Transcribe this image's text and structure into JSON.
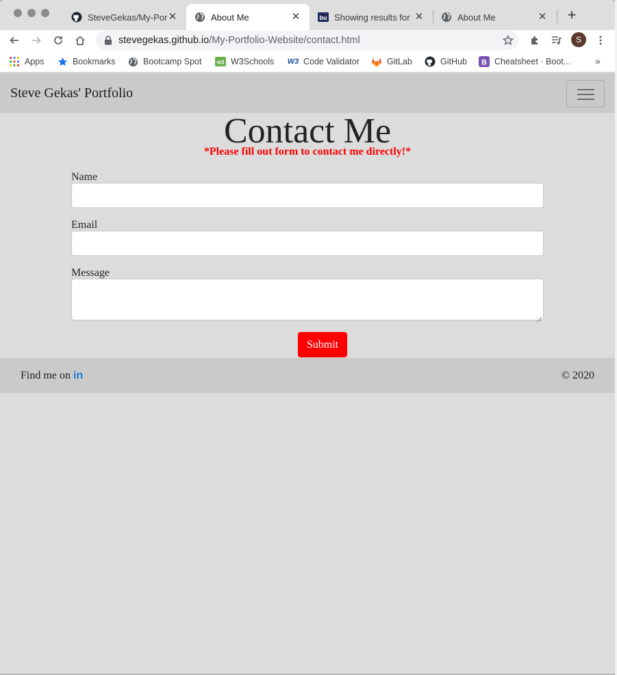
{
  "browser": {
    "tabs": [
      {
        "title": "SteveGekas/My-Port",
        "icon": "github-icon"
      },
      {
        "title": "About Me",
        "icon": "globe-icon",
        "active": true
      },
      {
        "title": "Showing results for",
        "icon": "bu-icon"
      },
      {
        "title": "About Me",
        "icon": "globe-icon"
      }
    ],
    "url_host": "stevegekas.github.io",
    "url_path": "/My-Portfolio-Website/contact.html",
    "avatar_letter": "S",
    "bookmarks": [
      {
        "label": "Apps",
        "icon": "apps-grid-icon"
      },
      {
        "label": "Bookmarks",
        "icon": "star-icon"
      },
      {
        "label": "Bootcamp Spot",
        "icon": "globe-icon"
      },
      {
        "label": "W3Schools",
        "icon": "w3schools-icon"
      },
      {
        "label": "Code Validator",
        "icon": "w3c-icon"
      },
      {
        "label": "GitLab",
        "icon": "gitlab-icon"
      },
      {
        "label": "GitHub",
        "icon": "github-icon"
      },
      {
        "label": "Cheatsheet · Boot...",
        "icon": "bootstrap-icon"
      }
    ],
    "more_label": "»"
  },
  "page": {
    "brand": "Steve Gekas' Portfolio",
    "heading": "Contact Me",
    "subheading": "*Please fill out form to contact me directly!*",
    "form": {
      "name_label": "Name",
      "name_value": "",
      "email_label": "Email",
      "email_value": "",
      "message_label": "Message",
      "message_value": "",
      "submit_label": "Submit"
    },
    "footer": {
      "find_label": "Find me on",
      "linkedin_text": "in",
      "copyright": "© 2020"
    }
  },
  "colors": {
    "accent_red": "#ff0000",
    "linkedin_blue": "#1b7bd1",
    "navbar_bg": "#cacaca",
    "page_bg": "#dcdcdc"
  }
}
